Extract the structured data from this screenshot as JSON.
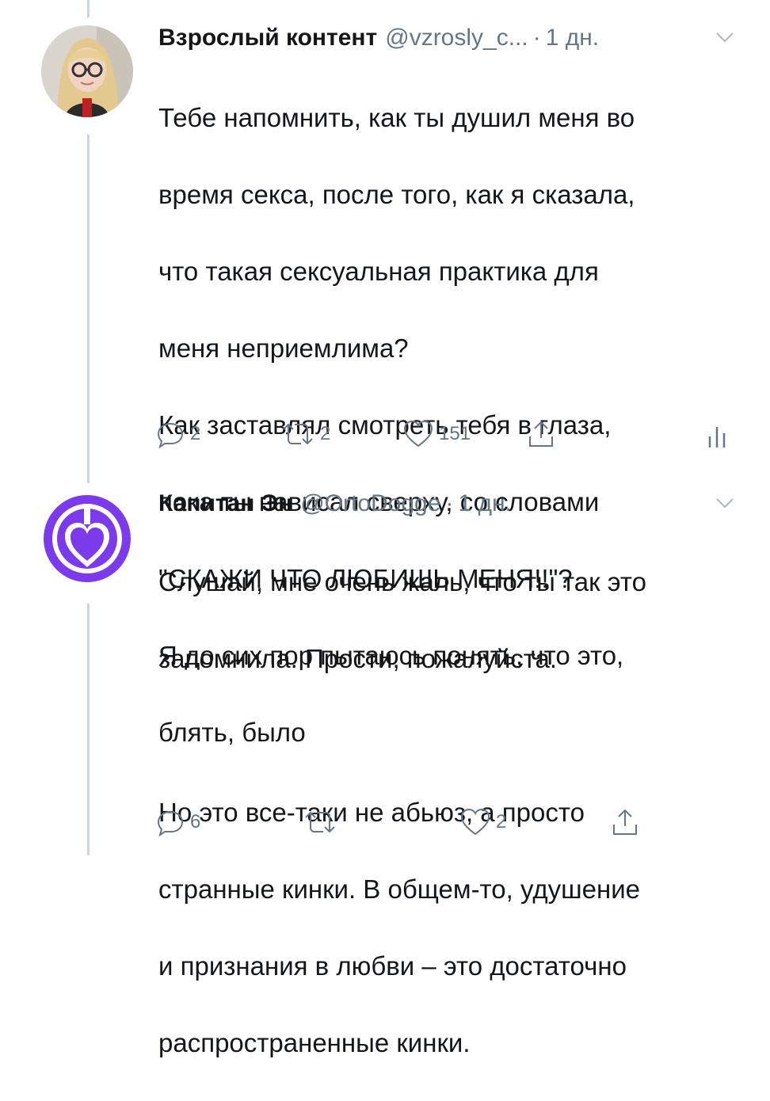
{
  "colors": {
    "text": "#14171a",
    "muted": "#657786",
    "thread_line": "#ccd6dd",
    "ortodogge_purple": "#7c3aed"
  },
  "tweets": [
    {
      "display_name": "Взрослый контент",
      "handle": "@vzrosly_c...",
      "separator": "·",
      "time": "1 дн.",
      "avatar_icon": "user-photo-avatar",
      "lines": [
        "Тебе напомнить, как ты душил меня во",
        "время секса, после того, как я сказала,",
        "что такая сексуальная практика для",
        "меня неприемлима?",
        "Как заставлял смотреть тебя в глаза,",
        "пока ты нависал сверху, со словами",
        "\"СКАЖИ ЧТО ЛЮБИШЬ МЕНЯ!!\"?",
        "Я до сих пор пытаюсь понять, что это,",
        "блять, было"
      ],
      "reply_count": "2",
      "retweet_count": "2",
      "like_count": "151"
    },
    {
      "display_name": "Капитан Эн",
      "handle": "@OrtoDogge",
      "separator": "·",
      "time": "1 дн.",
      "avatar_icon": "purple-heart-logo-avatar",
      "lines": [
        "Слушай, мне очень жаль, что ты так это",
        "запомнила. Прости, пожалуйста.",
        "",
        "Но это все-таки не абьюз, а просто",
        "странные кинки. В общем-то, удушение",
        "и признания в любви – это достаточно",
        "распространенные кинки."
      ],
      "reply_count": "6",
      "retweet_count": "",
      "like_count": "2"
    }
  ]
}
